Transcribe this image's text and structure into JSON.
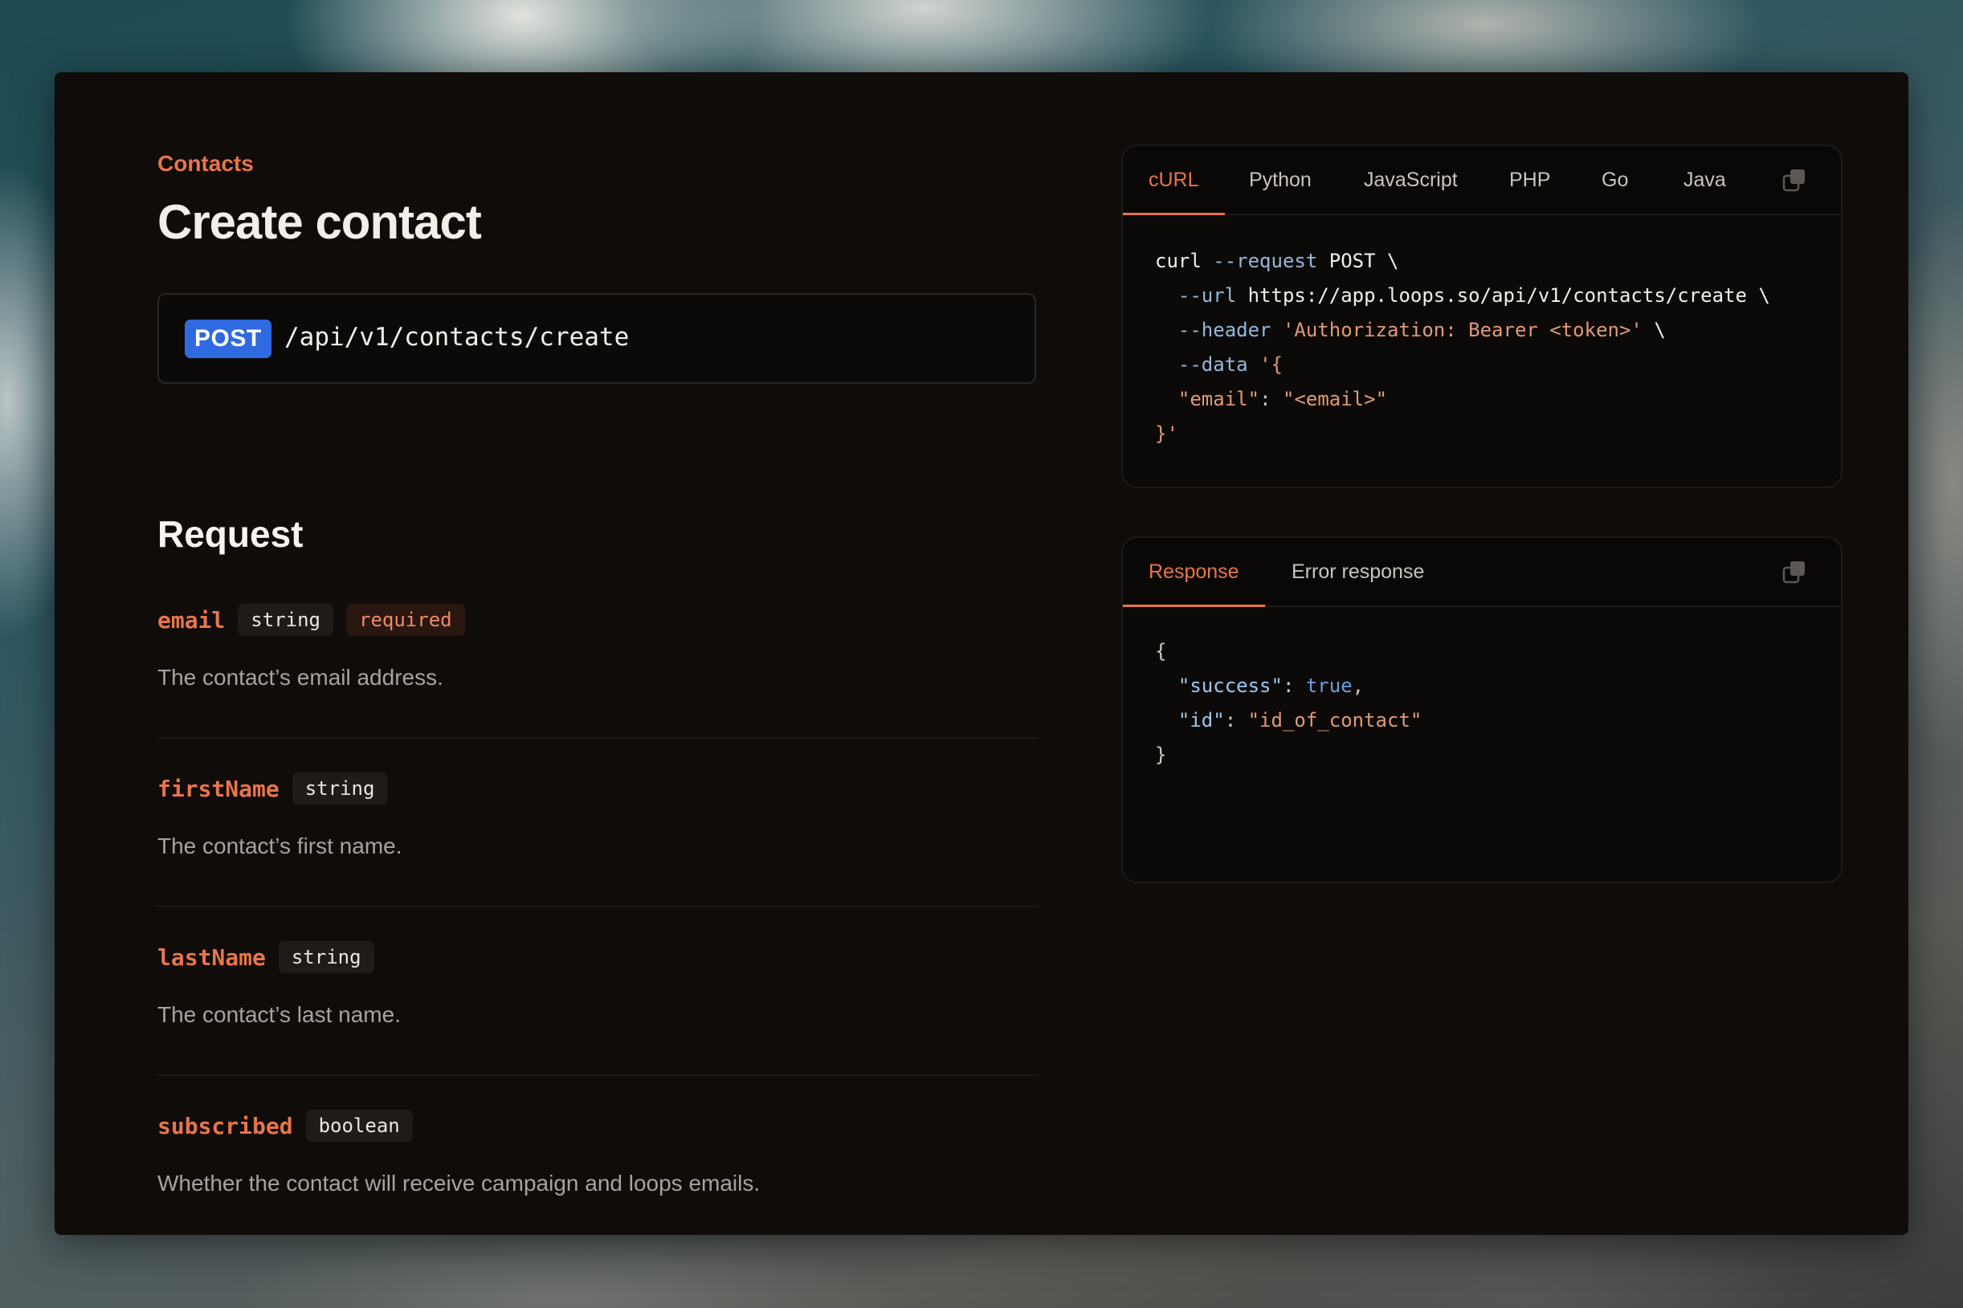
{
  "breadcrumb": "Contacts",
  "page_title": "Create contact",
  "endpoint": {
    "method": "POST",
    "path": "/api/v1/contacts/create"
  },
  "request": {
    "title": "Request",
    "params": [
      {
        "name": "email",
        "type": "string",
        "required_label": "required",
        "description": "The contact’s email address."
      },
      {
        "name": "firstName",
        "type": "string",
        "description": "The contact’s first name."
      },
      {
        "name": "lastName",
        "type": "string",
        "description": "The contact’s last name."
      },
      {
        "name": "subscribed",
        "type": "boolean",
        "description": "Whether the contact will receive campaign and loops emails."
      }
    ]
  },
  "code_panel": {
    "tabs": [
      "cURL",
      "Python",
      "JavaScript",
      "PHP",
      "Go",
      "Java"
    ],
    "active_tab": "cURL",
    "lines": [
      {
        "cmd": "curl",
        "flag": "--request",
        "value": "POST",
        "cont": "\\"
      },
      {
        "flag": "--url",
        "value": "https://app.loops.so/api/v1/contacts/create",
        "cont": "\\"
      },
      {
        "flag": "--header",
        "str": "'Authorization: Bearer <token>'",
        "cont": "\\"
      },
      {
        "flag": "--data",
        "str": "'{"
      },
      {
        "key": "\"email\"",
        "sep": ":",
        "str": "\"<email>\""
      },
      {
        "str": "}'"
      }
    ]
  },
  "response_panel": {
    "tabs": [
      "Response",
      "Error response"
    ],
    "active_tab": "Response",
    "lines": [
      {
        "punc": "{"
      },
      {
        "key": "\"success\"",
        "sep": ":",
        "bool": "true",
        "end": ","
      },
      {
        "key": "\"id\"",
        "sep": ":",
        "str": "\"id_of_contact\""
      },
      {
        "punc": "}"
      }
    ]
  },
  "colors": {
    "accent": "#e8754a",
    "method_post": "#2f6ae0",
    "card_bg": "#0f0c0a"
  }
}
